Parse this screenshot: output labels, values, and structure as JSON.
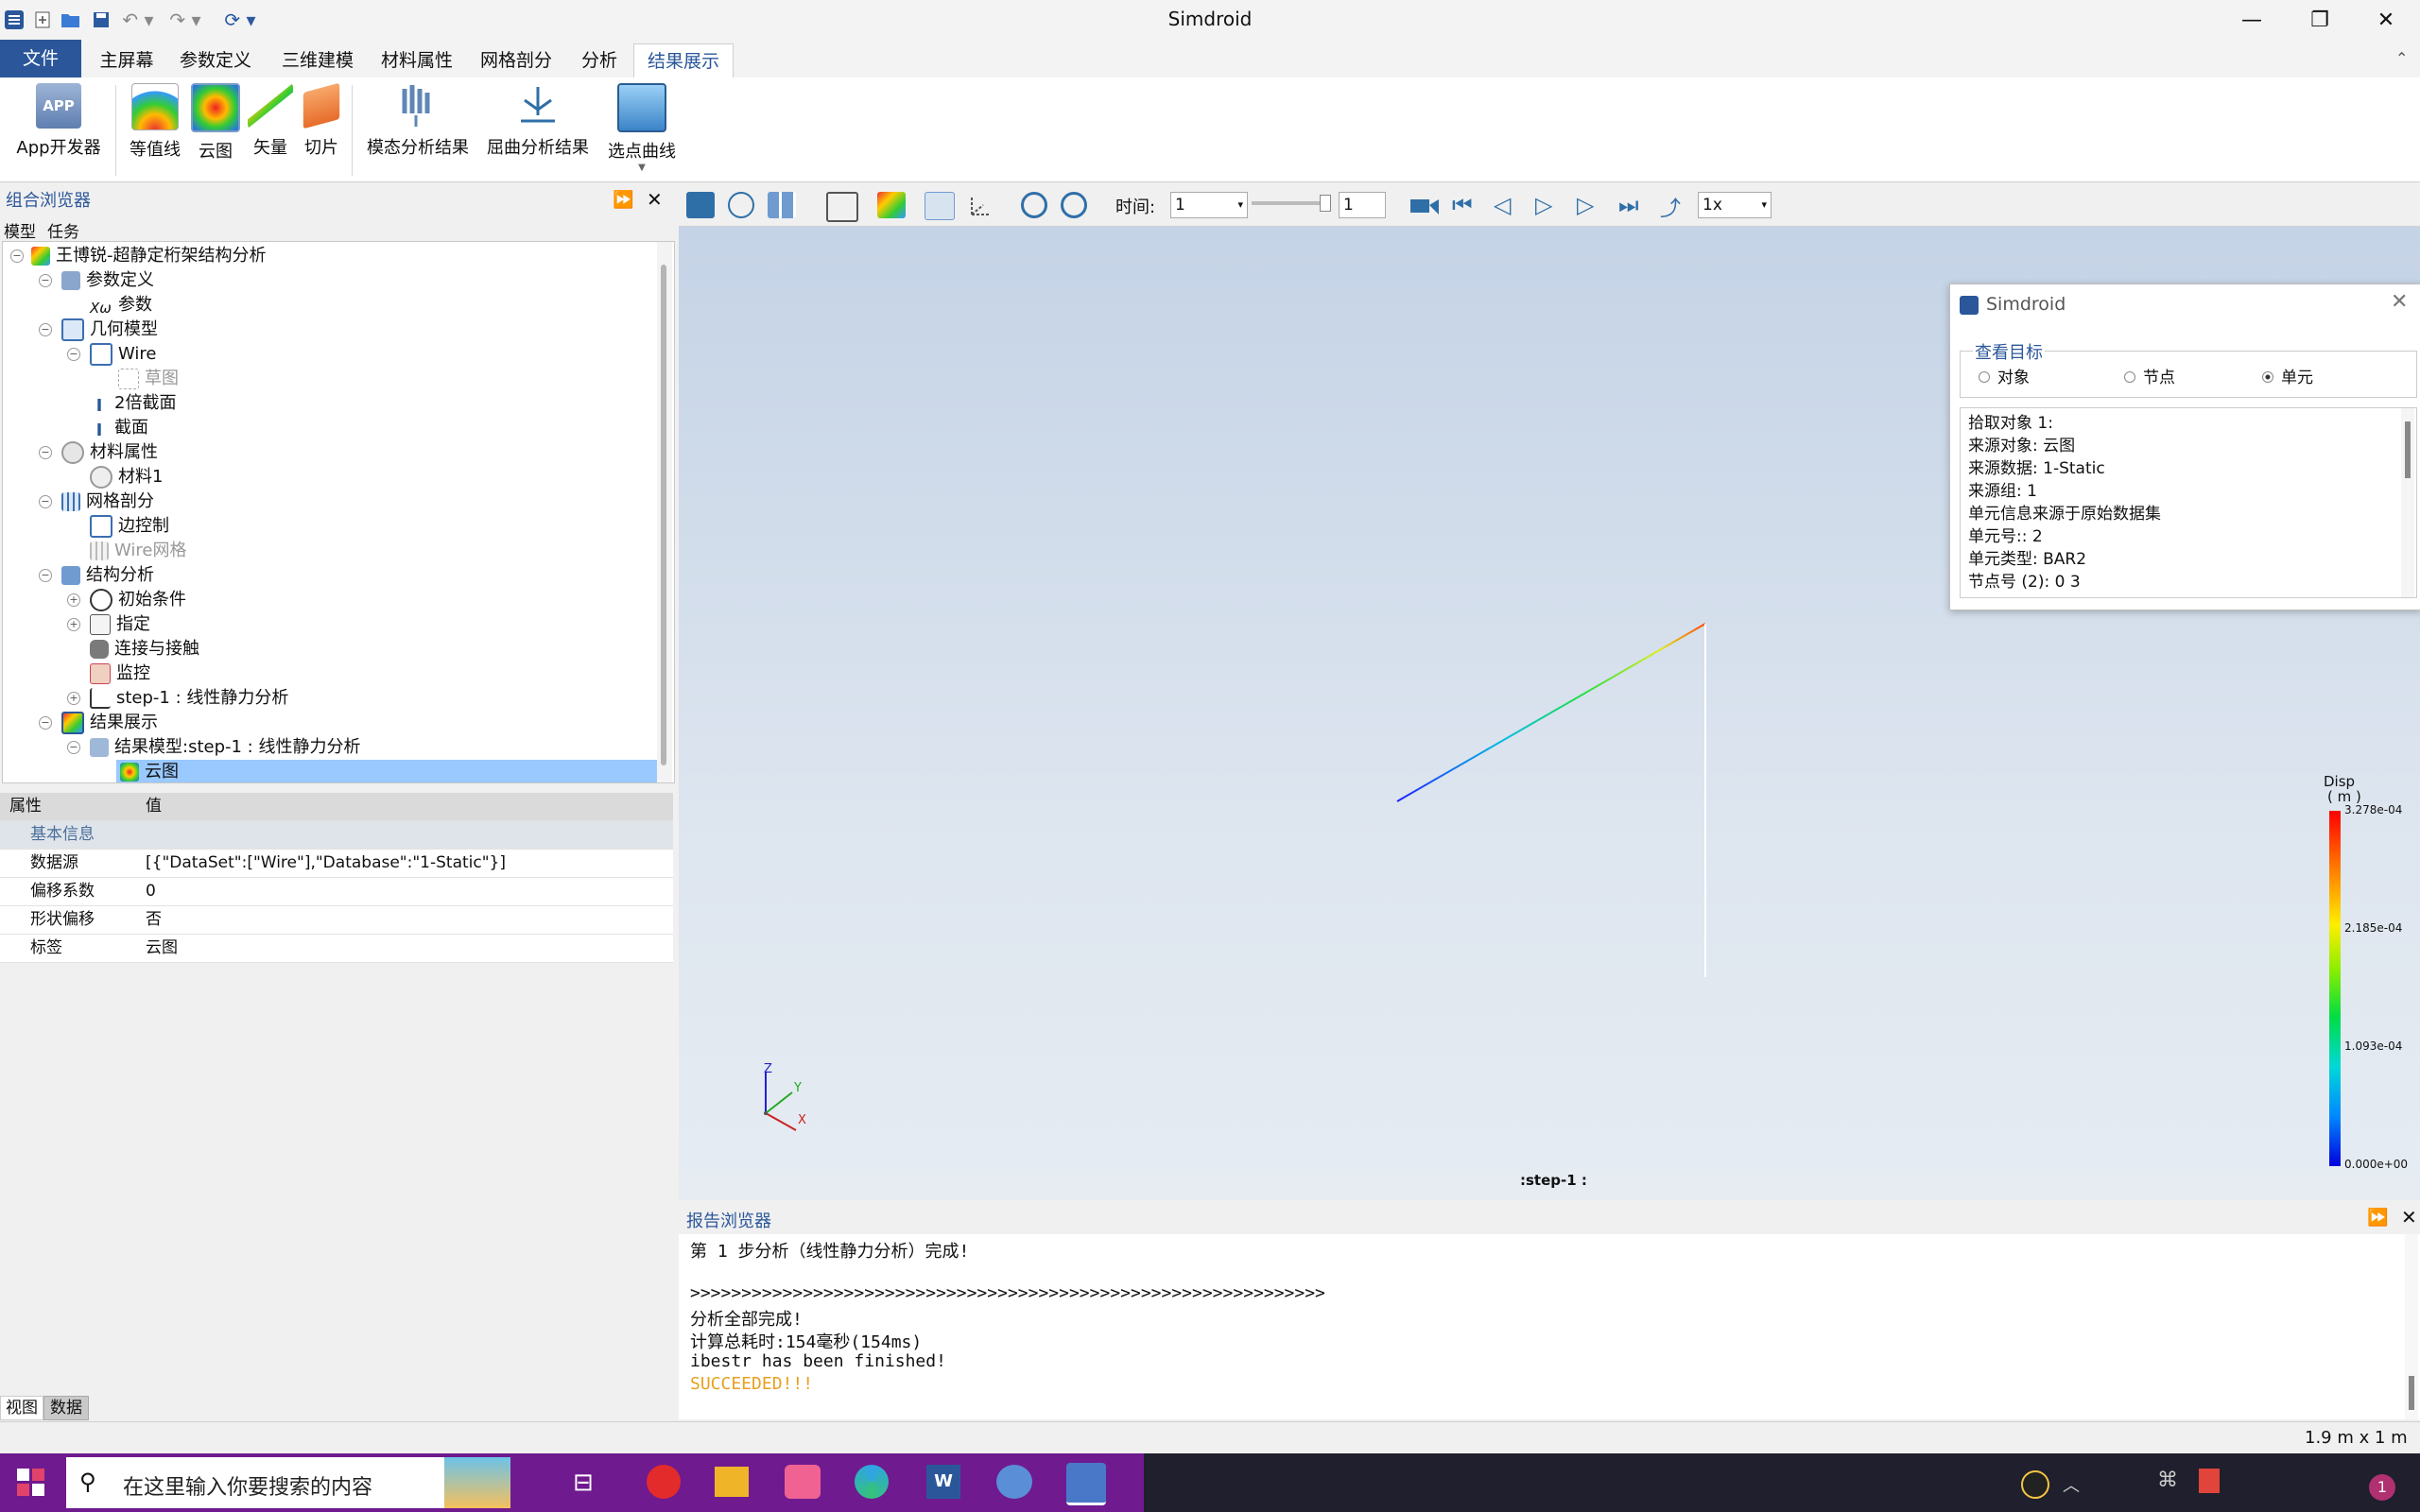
{
  "app": {
    "title": "Simdroid"
  },
  "window_controls": {
    "minimize": "—",
    "restore": "❐",
    "close": "✕"
  },
  "tabs": [
    {
      "label": "文件"
    },
    {
      "label": "主屏幕"
    },
    {
      "label": "参数定义"
    },
    {
      "label": "三维建模"
    },
    {
      "label": "材料属性"
    },
    {
      "label": "网格剖分"
    },
    {
      "label": "分析"
    },
    {
      "label": "结果展示"
    }
  ],
  "ribbon": {
    "buttons": [
      {
        "label": "App开发器",
        "icon_text": "APP"
      },
      {
        "label": "等值线"
      },
      {
        "label": "云图"
      },
      {
        "label": "矢量"
      },
      {
        "label": "切片"
      },
      {
        "label": "模态分析结果"
      },
      {
        "label": "屈曲分析结果"
      },
      {
        "label": "选点曲线"
      }
    ]
  },
  "left_panel": {
    "title": "组合浏览器",
    "tabs": [
      "模型",
      "任务"
    ],
    "tree": [
      {
        "label": "王博锐-超静定桁架结构分析"
      },
      {
        "label": "参数定义"
      },
      {
        "label": "参数",
        "icon_text": "Xω"
      },
      {
        "label": "几何模型"
      },
      {
        "label": "Wire"
      },
      {
        "label": "草图"
      },
      {
        "label": "2倍截面"
      },
      {
        "label": "截面"
      },
      {
        "label": "材料属性"
      },
      {
        "label": "材料1"
      },
      {
        "label": "网格剖分"
      },
      {
        "label": "边控制"
      },
      {
        "label": "Wire网格"
      },
      {
        "label": "结构分析"
      },
      {
        "label": "初始条件"
      },
      {
        "label": "指定"
      },
      {
        "label": "连接与接触"
      },
      {
        "label": "监控"
      },
      {
        "label": "step-1 : 线性静力分析"
      },
      {
        "label": "结果展示"
      },
      {
        "label": "结果模型:step-1 : 线性静力分析"
      },
      {
        "label": "云图"
      }
    ],
    "bottom_tabs": [
      "视图",
      "数据"
    ]
  },
  "properties": {
    "header_key": "属性",
    "header_value": "值",
    "group": "基本信息",
    "rows": [
      {
        "key": "数据源",
        "value": "[{\"DataSet\":[\"Wire\"],\"Database\":\"1-Static\"}]"
      },
      {
        "key": "偏移系数",
        "value": "0"
      },
      {
        "key": "形状偏移",
        "value": "否"
      },
      {
        "key": "标签",
        "value": "云图"
      }
    ]
  },
  "toolbar3d": {
    "time_label": "时间:",
    "time_value": "1",
    "frame_value": "1",
    "speed_value": "1x"
  },
  "viewport": {
    "step_label": ":step-1 :",
    "legend": {
      "title": "Disp",
      "unit": "( m )",
      "ticks": [
        "3.278e-04",
        "2.185e-04",
        "1.093e-04",
        "0.000e+00"
      ]
    },
    "triad": {
      "x": "X",
      "y": "Y",
      "z": "Z"
    }
  },
  "popup": {
    "title": "Simdroid",
    "group_title": "查看目标",
    "options": [
      {
        "label": "对象",
        "selected": false
      },
      {
        "label": "节点",
        "selected": false
      },
      {
        "label": "单元",
        "selected": true
      }
    ],
    "info_lines": [
      "拾取对象 1:",
      "来源对象: 云图",
      "来源数据: 1-Static",
      "来源组: 1",
      "单元信息来源于原始数据集",
      "单元号:: 2",
      "单元类型: BAR2",
      "节点号 (2): 0 3"
    ]
  },
  "report": {
    "title": "报告浏览器",
    "lines": [
      "第 1 步分析（线性静力分析）完成!",
      "",
      ">>>>>>>>>>>>>>>>>>>>>>>>>>>>>>>>>>>>>>>>>>>>>>>>>>>>>>>>>>>>>>",
      "分析全部完成!",
      "计算总耗时:154毫秒(154ms)",
      "ibestr has been finished!",
      "SUCCEEDED!!!"
    ]
  },
  "status": {
    "dimensions": "1.9 m x 1 m"
  },
  "taskbar": {
    "search_placeholder": "在这里输入你要搜索的内容",
    "notification_count": "1"
  },
  "colors": {
    "accent": "#2b579a",
    "selection": "#99c9ff",
    "success": "#e8a020"
  }
}
